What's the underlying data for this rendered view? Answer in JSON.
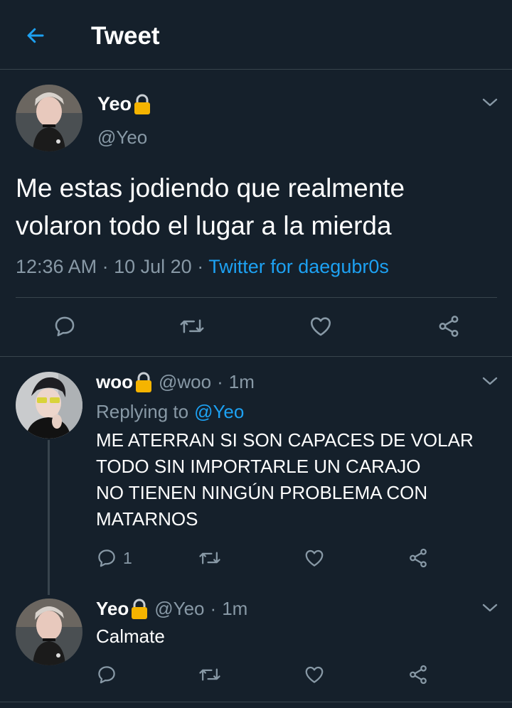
{
  "header": {
    "title": "Tweet",
    "back_icon": "arrow-left-icon",
    "accent_color": "#1da1f2"
  },
  "main_tweet": {
    "name": "Yeo",
    "handle": "@Yeo",
    "text": "Me estas jodiendo que realmente volaron todo el lugar a la mierda",
    "time": "12:36 AM",
    "sep1": "·",
    "date": "10 Jul 20",
    "sep2": "·",
    "source": "Twitter for daegubr0s",
    "actions": [
      "reply-icon",
      "retweet-icon",
      "like-icon",
      "share-icon"
    ]
  },
  "replies": [
    {
      "name": "woo",
      "handle": "@woo",
      "sep": "·",
      "time": "1m",
      "replying_label": "Replying to",
      "replying_to": "@Yeo",
      "lines": [
        "ME ATERRAN SI SON CAPACES DE VOLAR",
        "TODO SIN IMPORTARLE UN CARAJO",
        "NO TIENEN NINGÚN PROBLEMA CON",
        "MATARNOS"
      ],
      "reply_count": "1"
    },
    {
      "name": "Yeo",
      "handle": "@Yeo",
      "sep": "·",
      "time": "1m",
      "text": "Calmate"
    }
  ],
  "colors": {
    "background": "#15202b",
    "border": "#38444d",
    "muted": "#8899a6",
    "lock": "#f5b400"
  }
}
